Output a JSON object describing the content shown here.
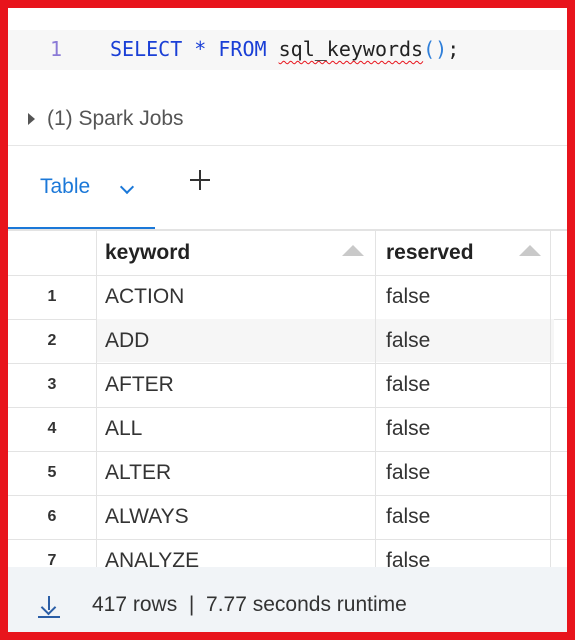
{
  "editor": {
    "line_number": "1",
    "tokens": {
      "select": "SELECT",
      "star": "*",
      "from": "FROM",
      "func": "sql_keywords",
      "parens": "()",
      "semi": ";"
    }
  },
  "spark_jobs": {
    "label": "(1) Spark Jobs"
  },
  "tabs": {
    "active_label": "Table"
  },
  "table": {
    "columns": [
      "keyword",
      "reserved"
    ],
    "rows": [
      {
        "n": "1",
        "keyword": "ACTION",
        "reserved": "false"
      },
      {
        "n": "2",
        "keyword": "ADD",
        "reserved": "false"
      },
      {
        "n": "3",
        "keyword": "AFTER",
        "reserved": "false"
      },
      {
        "n": "4",
        "keyword": "ALL",
        "reserved": "false"
      },
      {
        "n": "5",
        "keyword": "ALTER",
        "reserved": "false"
      },
      {
        "n": "6",
        "keyword": "ALWAYS",
        "reserved": "false"
      },
      {
        "n": "7",
        "keyword": "ANALYZE",
        "reserved": "false"
      }
    ]
  },
  "footer": {
    "rows_count": "417 rows",
    "separator": "|",
    "runtime": "7.77 seconds runtime",
    "download_icon": "download-icon"
  },
  "colors": {
    "frame": "#e8141c",
    "accent": "#1b78d8",
    "keyword_token": "#1a3fd6"
  }
}
